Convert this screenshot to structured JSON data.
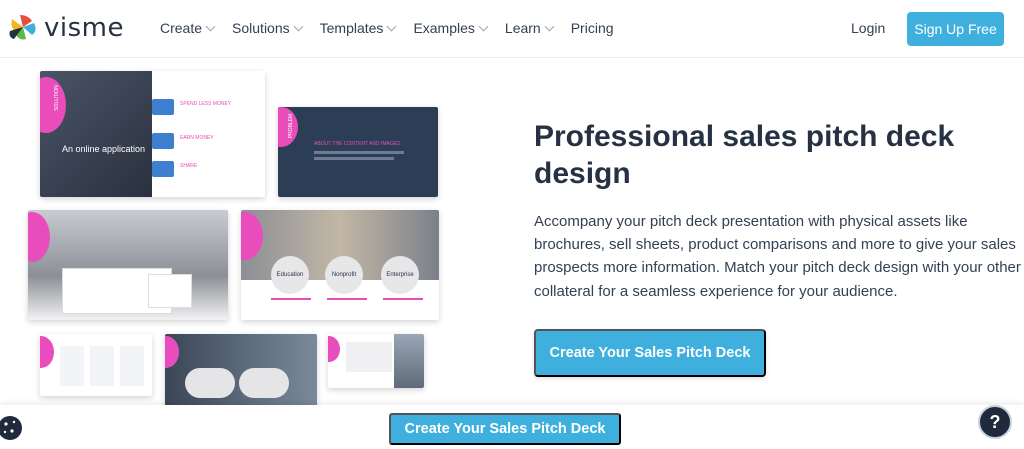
{
  "brand": {
    "name": "visme"
  },
  "nav": {
    "items": [
      {
        "label": "Create",
        "dropdown": true
      },
      {
        "label": "Solutions",
        "dropdown": true
      },
      {
        "label": "Templates",
        "dropdown": true
      },
      {
        "label": "Examples",
        "dropdown": true
      },
      {
        "label": "Learn",
        "dropdown": true
      },
      {
        "label": "Pricing",
        "dropdown": false
      }
    ],
    "login": "Login",
    "signup": "Sign Up Free"
  },
  "hero": {
    "title": "Professional sales pitch deck design",
    "paragraph": "Accompany your pitch deck presentation with physical assets like brochures, sell sheets, product comparisons and more to give your sales prospects more information. Match your pitch deck design with your other collateral for a seamless experience for your audience.",
    "cta": "Create Your Sales Pitch Deck"
  },
  "collage": {
    "slide1_heading": "An online application",
    "slide1_side": "SOLUTION",
    "slide1_items": [
      "SPEND LESS MONEY",
      "EARN MONEY",
      "SHARE"
    ],
    "slide2_heading": "ABOUT THE CONTENT AND IMAGES",
    "slide2_side": "PROBLEM",
    "slide4_labels": [
      "Education",
      "Nonprofit",
      "Enterprise"
    ]
  },
  "footer_bar": {
    "cta": "Create Your Sales Pitch Deck"
  },
  "colors": {
    "accent": "#3fb0de",
    "pink": "#e94dbb",
    "navy": "#263143",
    "slate": "#2c3e55"
  },
  "icons": [
    "logo-icon",
    "chevron-down-icon",
    "cookie-icon",
    "help-icon"
  ]
}
